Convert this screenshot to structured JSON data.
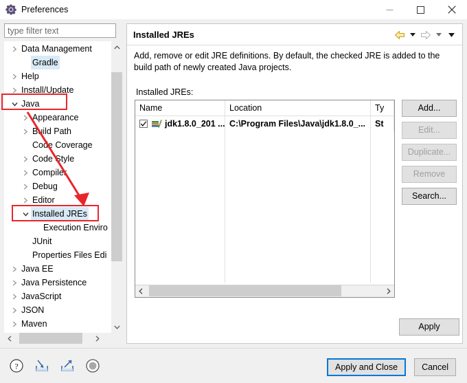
{
  "window": {
    "title": "Preferences",
    "icon": "gear-icon",
    "controls": {
      "minimize": "minimize-icon",
      "maximize": "maximize-icon",
      "close": "close-icon"
    }
  },
  "sidebar": {
    "filter": {
      "placeholder": "type filter text",
      "value": ""
    },
    "items": [
      {
        "label": "Data Management",
        "indent": 0,
        "twisty": "collapsed",
        "selected": false
      },
      {
        "label": "Gradle",
        "indent": 1,
        "twisty": "none",
        "selected": true
      },
      {
        "label": "Help",
        "indent": 0,
        "twisty": "collapsed",
        "selected": false
      },
      {
        "label": "Install/Update",
        "indent": 0,
        "twisty": "collapsed",
        "selected": false
      },
      {
        "label": "Java",
        "indent": 0,
        "twisty": "expanded",
        "selected": false
      },
      {
        "label": "Appearance",
        "indent": 1,
        "twisty": "collapsed",
        "selected": false
      },
      {
        "label": "Build Path",
        "indent": 1,
        "twisty": "collapsed",
        "selected": false
      },
      {
        "label": "Code Coverage",
        "indent": 1,
        "twisty": "none",
        "selected": false
      },
      {
        "label": "Code Style",
        "indent": 1,
        "twisty": "collapsed",
        "selected": false
      },
      {
        "label": "Compiler",
        "indent": 1,
        "twisty": "collapsed",
        "selected": false
      },
      {
        "label": "Debug",
        "indent": 1,
        "twisty": "collapsed",
        "selected": false
      },
      {
        "label": "Editor",
        "indent": 1,
        "twisty": "collapsed",
        "selected": false
      },
      {
        "label": "Installed JREs",
        "indent": 1,
        "twisty": "expanded",
        "selected": true
      },
      {
        "label": "Execution Enviro",
        "indent": 2,
        "twisty": "none",
        "selected": false
      },
      {
        "label": "JUnit",
        "indent": 1,
        "twisty": "none",
        "selected": false
      },
      {
        "label": "Properties Files Edi",
        "indent": 1,
        "twisty": "none",
        "selected": false
      },
      {
        "label": "Java EE",
        "indent": 0,
        "twisty": "collapsed",
        "selected": false
      },
      {
        "label": "Java Persistence",
        "indent": 0,
        "twisty": "collapsed",
        "selected": false
      },
      {
        "label": "JavaScript",
        "indent": 0,
        "twisty": "collapsed",
        "selected": false
      },
      {
        "label": "JSON",
        "indent": 0,
        "twisty": "collapsed",
        "selected": false
      },
      {
        "label": "Maven",
        "indent": 0,
        "twisty": "collapsed",
        "selected": false
      }
    ]
  },
  "panel": {
    "title": "Installed JREs",
    "description": "Add, remove or edit JRE definitions. By default, the checked JRE is added to the build path of newly created Java projects.",
    "list_label": "Installed JREs:",
    "nav": {
      "back": "back-arrow-icon",
      "back_menu": "chevron-down-icon",
      "forward": "forward-arrow-icon",
      "forward_menu": "chevron-down-icon",
      "view_menu": "chevron-down-icon"
    },
    "table": {
      "columns": [
        "Name",
        "Location",
        "Ty"
      ],
      "rows": [
        {
          "checked": true,
          "icon": "jre-icon",
          "name": "jdk1.8.0_201 ...",
          "location": "C:\\Program Files\\Java\\jdk1.8.0_...",
          "type": "St"
        }
      ],
      "empty_row_count": 10
    },
    "buttons": [
      {
        "label": "Add...",
        "enabled": true
      },
      {
        "label": "Edit...",
        "enabled": false
      },
      {
        "label": "Duplicate...",
        "enabled": false
      },
      {
        "label": "Remove",
        "enabled": false
      },
      {
        "label": "Search...",
        "enabled": true
      }
    ],
    "apply_label": "Apply"
  },
  "footer": {
    "icons": [
      {
        "name": "help-icon"
      },
      {
        "name": "import-icon"
      },
      {
        "name": "export-icon"
      },
      {
        "name": "restore-defaults-icon"
      }
    ],
    "buttons": [
      {
        "label": "Apply and Close",
        "default": true
      },
      {
        "label": "Cancel",
        "default": false
      }
    ]
  },
  "annotations": {
    "color": "#e8262a",
    "boxes": [
      {
        "target": "Java"
      },
      {
        "target": "Installed JREs"
      }
    ],
    "arrow": {
      "from": "Java",
      "to": "Installed JREs"
    }
  }
}
